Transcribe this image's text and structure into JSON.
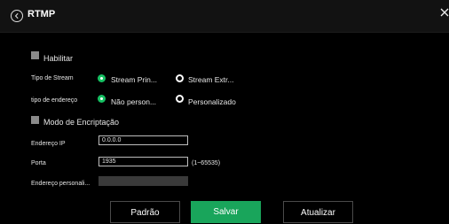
{
  "header": {
    "title": "RTMP"
  },
  "form": {
    "enable_label": "Habilitar",
    "stream_type": {
      "label": "Tipo de Stream",
      "options": [
        "Stream Prin...",
        "Stream Extr..."
      ]
    },
    "address_type": {
      "label": "tipo de endereço",
      "options": [
        "Não person...",
        "Personalizado"
      ]
    },
    "encryption_label": "Modo de Encriptação",
    "ip": {
      "label": "Endereço IP",
      "value": "0.0.0.0"
    },
    "port": {
      "label": "Porta",
      "value": "1935",
      "hint": "(1~65535)"
    },
    "custom_address": {
      "label": "Endereço personali...",
      "value": ""
    }
  },
  "buttons": {
    "default": "Padrão",
    "save": "Salvar",
    "refresh": "Atualizar"
  },
  "colors": {
    "accent": "#19a55b",
    "background": "#000000"
  },
  "icons": {
    "back": "circle-chevron-left-icon",
    "close": "close-icon"
  }
}
